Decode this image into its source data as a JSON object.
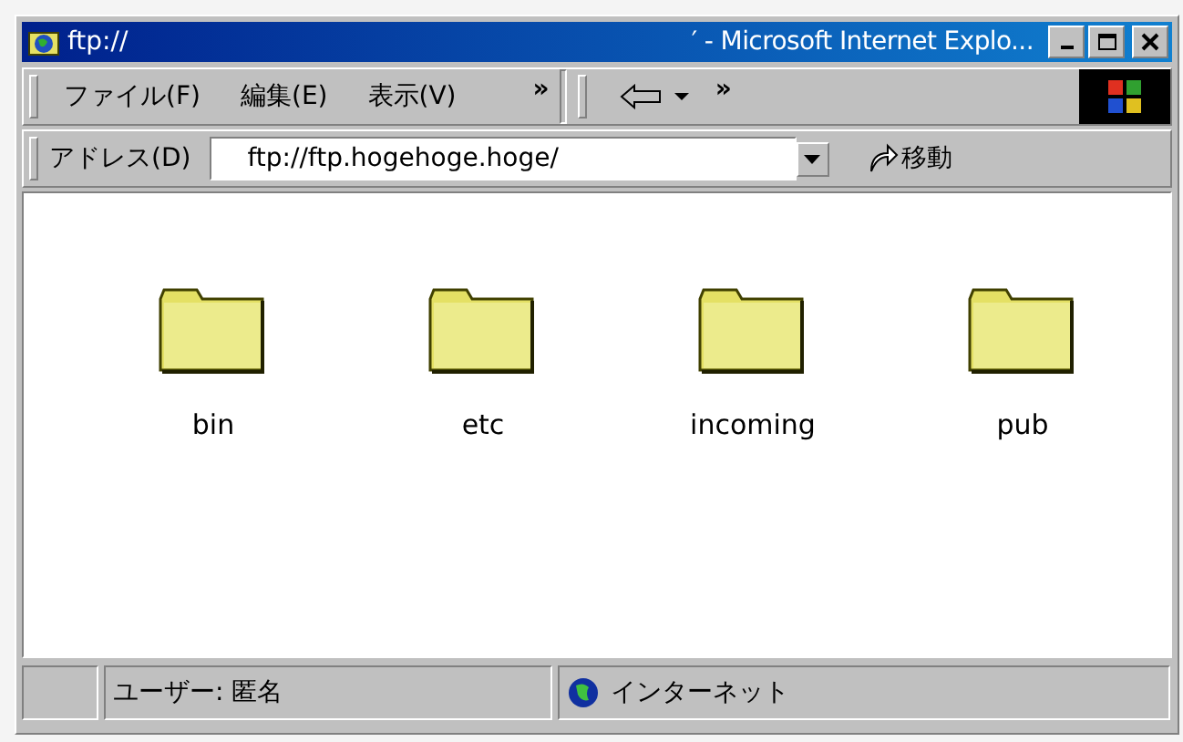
{
  "window": {
    "title": "ftp://",
    "title_tail": "′ - Microsoft Internet Explo..."
  },
  "menu": [
    "ファイル(F)",
    "編集(E)",
    "表示(V)"
  ],
  "menu_chevron": "»",
  "toolbar_chevron": "»",
  "address": {
    "label": "アドレス(D)",
    "value": "ftp://ftp.hogehoge.hoge/",
    "go": "移動"
  },
  "folders": [
    {
      "name": "bin"
    },
    {
      "name": "etc"
    },
    {
      "name": "incoming"
    },
    {
      "name": "pub"
    }
  ],
  "status_bar": {
    "user": "ユーザー: 匿名",
    "zone": "インターネット"
  }
}
